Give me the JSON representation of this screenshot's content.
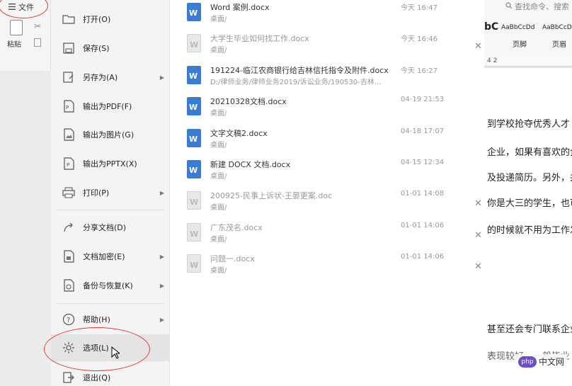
{
  "app": {
    "file_tab": "文件",
    "paste_label": "粘贴",
    "search_placeholder": "查找命令、搜索",
    "style_big": "bC",
    "styles": [
      "AaBbCcDd",
      "AaBbCcDd"
    ],
    "style_names": [
      "页脚",
      "页眉"
    ],
    "ruler_text": "4    2"
  },
  "menu": {
    "items": [
      {
        "label": "打开(O)",
        "icon": "folder-icon",
        "arrow": false
      },
      {
        "label": "保存(S)",
        "icon": "save-icon",
        "arrow": false
      },
      {
        "label": "另存为(A)",
        "icon": "save-as-icon",
        "arrow": true
      },
      {
        "label": "输出为PDF(F)",
        "icon": "pdf-icon",
        "arrow": false
      },
      {
        "label": "输出为图片(G)",
        "icon": "image-icon",
        "arrow": false
      },
      {
        "label": "输出为PPTX(X)",
        "icon": "pptx-icon",
        "arrow": false
      },
      {
        "label": "打印(P)",
        "icon": "print-icon",
        "arrow": true
      },
      {
        "label": "分享文档(D)",
        "icon": "share-icon",
        "arrow": false
      },
      {
        "label": "文档加密(E)",
        "icon": "lock-icon",
        "arrow": true
      },
      {
        "label": "备份与恢复(K)",
        "icon": "backup-icon",
        "arrow": true
      },
      {
        "label": "帮助(H)",
        "icon": "help-icon",
        "arrow": true
      },
      {
        "label": "选项(L)",
        "icon": "gear-icon",
        "arrow": false
      },
      {
        "label": "退出(Q)",
        "icon": "exit-icon",
        "arrow": false
      }
    ]
  },
  "recent_files": [
    {
      "name": "Word 案例.docx",
      "path": "桌面/",
      "time": "今天 16:47",
      "type": "blue",
      "dim": false,
      "close": false
    },
    {
      "name": "大学生毕业如何找工作.docx",
      "path": "桌面/",
      "time": "今天 16:46",
      "type": "gray",
      "dim": true,
      "close": true
    },
    {
      "name": "191224-临江农商银行给吉林信托指令及附件.docx",
      "path": "D:/律师业务/律师业务2019/诉讼业务/190530-吉林...",
      "time": "今天 16:27",
      "type": "blue",
      "dim": false,
      "close": false
    },
    {
      "name": "20210328文档.docx",
      "path": "桌面/",
      "time": "04-19 21:53",
      "type": "blue",
      "dim": false,
      "close": false
    },
    {
      "name": "文字文稿2.docx",
      "path": "桌面/",
      "time": "04-18 17:07",
      "type": "blue",
      "dim": false,
      "close": false
    },
    {
      "name": "新建 DOCX 文档.docx",
      "path": "桌面/",
      "time": "04-15 12:34",
      "type": "blue",
      "dim": false,
      "close": false
    },
    {
      "name": "200925-民事上诉状-王晏更案.doc",
      "path": "桌面/",
      "time": "01-01 14:08",
      "type": "gray",
      "dim": true,
      "close": true
    },
    {
      "name": "广东茂名.docx",
      "path": "桌面/",
      "time": "01-01 14:06",
      "type": "gray",
      "dim": true,
      "close": true
    },
    {
      "name": "问题一.docx",
      "path": "桌面/",
      "time": "01-01 14:06",
      "type": "gray",
      "dim": true,
      "close": true
    }
  ],
  "document_lines": [
    "到学校抢夺优秀人才",
    "企业，如果有喜欢的企",
    "及投递简历。另外，并",
    "你是大三的学生，也可",
    "的时候就不用为工作发",
    "甚至还会专门联系企业",
    "表现较好，一般毕业"
  ],
  "watermark": {
    "logo": "php",
    "text": "中文网"
  }
}
